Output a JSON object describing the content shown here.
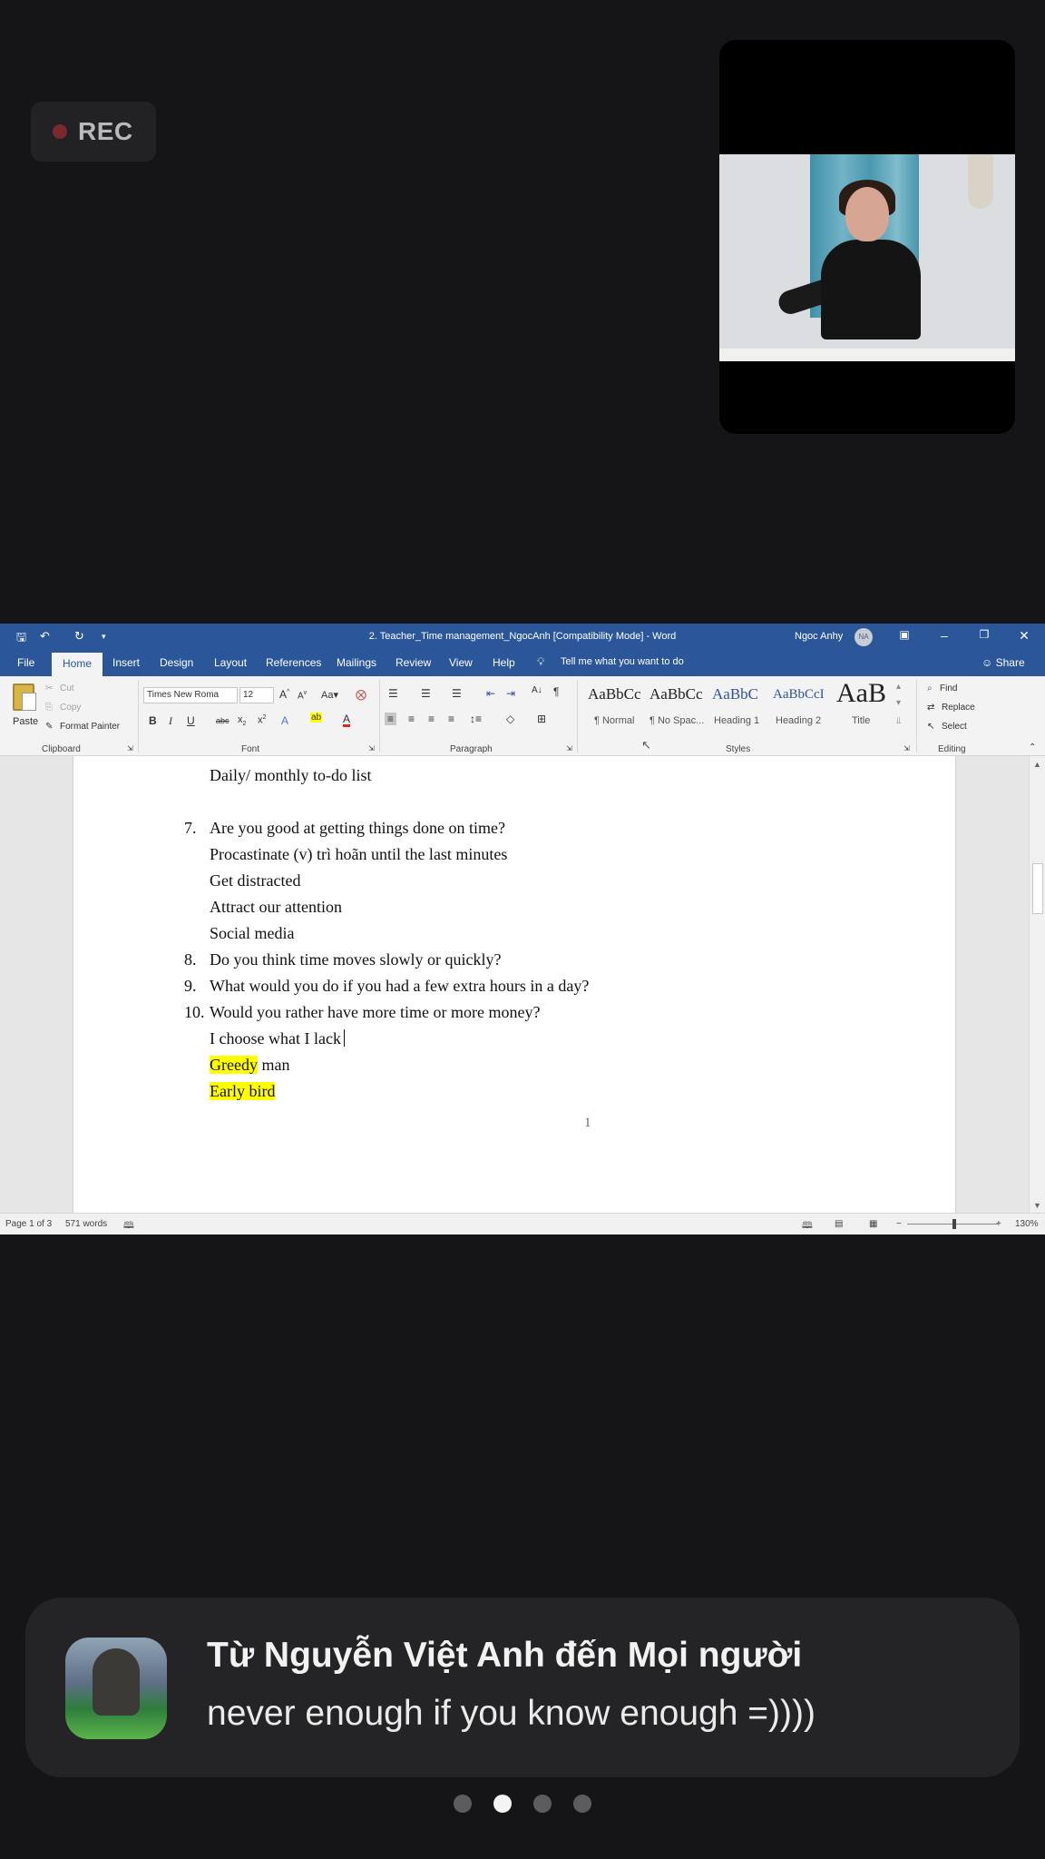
{
  "rec": {
    "label": "REC"
  },
  "word": {
    "title": "2. Teacher_Time management_NgocAnh [Compatibility Mode]  -  Word",
    "user": "Ngoc Anhy",
    "user_initials": "NA",
    "tabs": [
      "File",
      "Home",
      "Insert",
      "Design",
      "Layout",
      "References",
      "Mailings",
      "Review",
      "View",
      "Help"
    ],
    "tell_me": "Tell me what you want to do",
    "share": "Share",
    "clipboard": {
      "paste": "Paste",
      "cut": "Cut",
      "copy": "Copy",
      "format_painter": "Format Painter",
      "label": "Clipboard"
    },
    "font": {
      "name": "Times New Roma",
      "size": "12",
      "label": "Font"
    },
    "paragraph": {
      "label": "Paragraph"
    },
    "styles": {
      "label": "Styles",
      "items": [
        {
          "sample": "AaBbCc",
          "name": "¶ Normal"
        },
        {
          "sample": "AaBbCc",
          "name": "¶ No Spac..."
        },
        {
          "sample": "AaBbC",
          "name": "Heading 1"
        },
        {
          "sample": "AaBbCcI",
          "name": "Heading 2"
        },
        {
          "sample": "AaB",
          "name": "Title"
        }
      ]
    },
    "editing": {
      "find": "Find",
      "replace": "Replace",
      "select": "Select",
      "label": "Editing"
    },
    "document": {
      "lines": [
        {
          "num": "",
          "text": "Daily/ monthly to-do list"
        },
        {
          "num": "7.",
          "text": "Are you good at getting things done on time?"
        },
        {
          "num": "",
          "text": "Procastinate (v) trì hoãn until the last minutes"
        },
        {
          "num": "",
          "text": "Get distracted"
        },
        {
          "num": "",
          "text": "Attract our attention"
        },
        {
          "num": "",
          "text": "Social media"
        },
        {
          "num": "8.",
          "text": "Do you think time moves slowly or quickly?"
        },
        {
          "num": "9.",
          "text": "What would you do if you had a few extra hours in a day?"
        },
        {
          "num": "10.",
          "text": "Would you rather have more time or more money?"
        },
        {
          "num": "",
          "text": "I choose what I lack"
        }
      ],
      "greedy_highlight": "Greedy",
      "greedy_rest": " man",
      "early_bird": "Early bird",
      "page_number": "1"
    },
    "status": {
      "page": "Page 1 of 3",
      "words": "571 words",
      "zoom": "130%"
    }
  },
  "chat": {
    "from": "Từ Nguyễn Việt Anh đến Mọi người",
    "message": "never enough if you know enough =))))"
  },
  "pager": {
    "count": 4,
    "active": 2
  }
}
